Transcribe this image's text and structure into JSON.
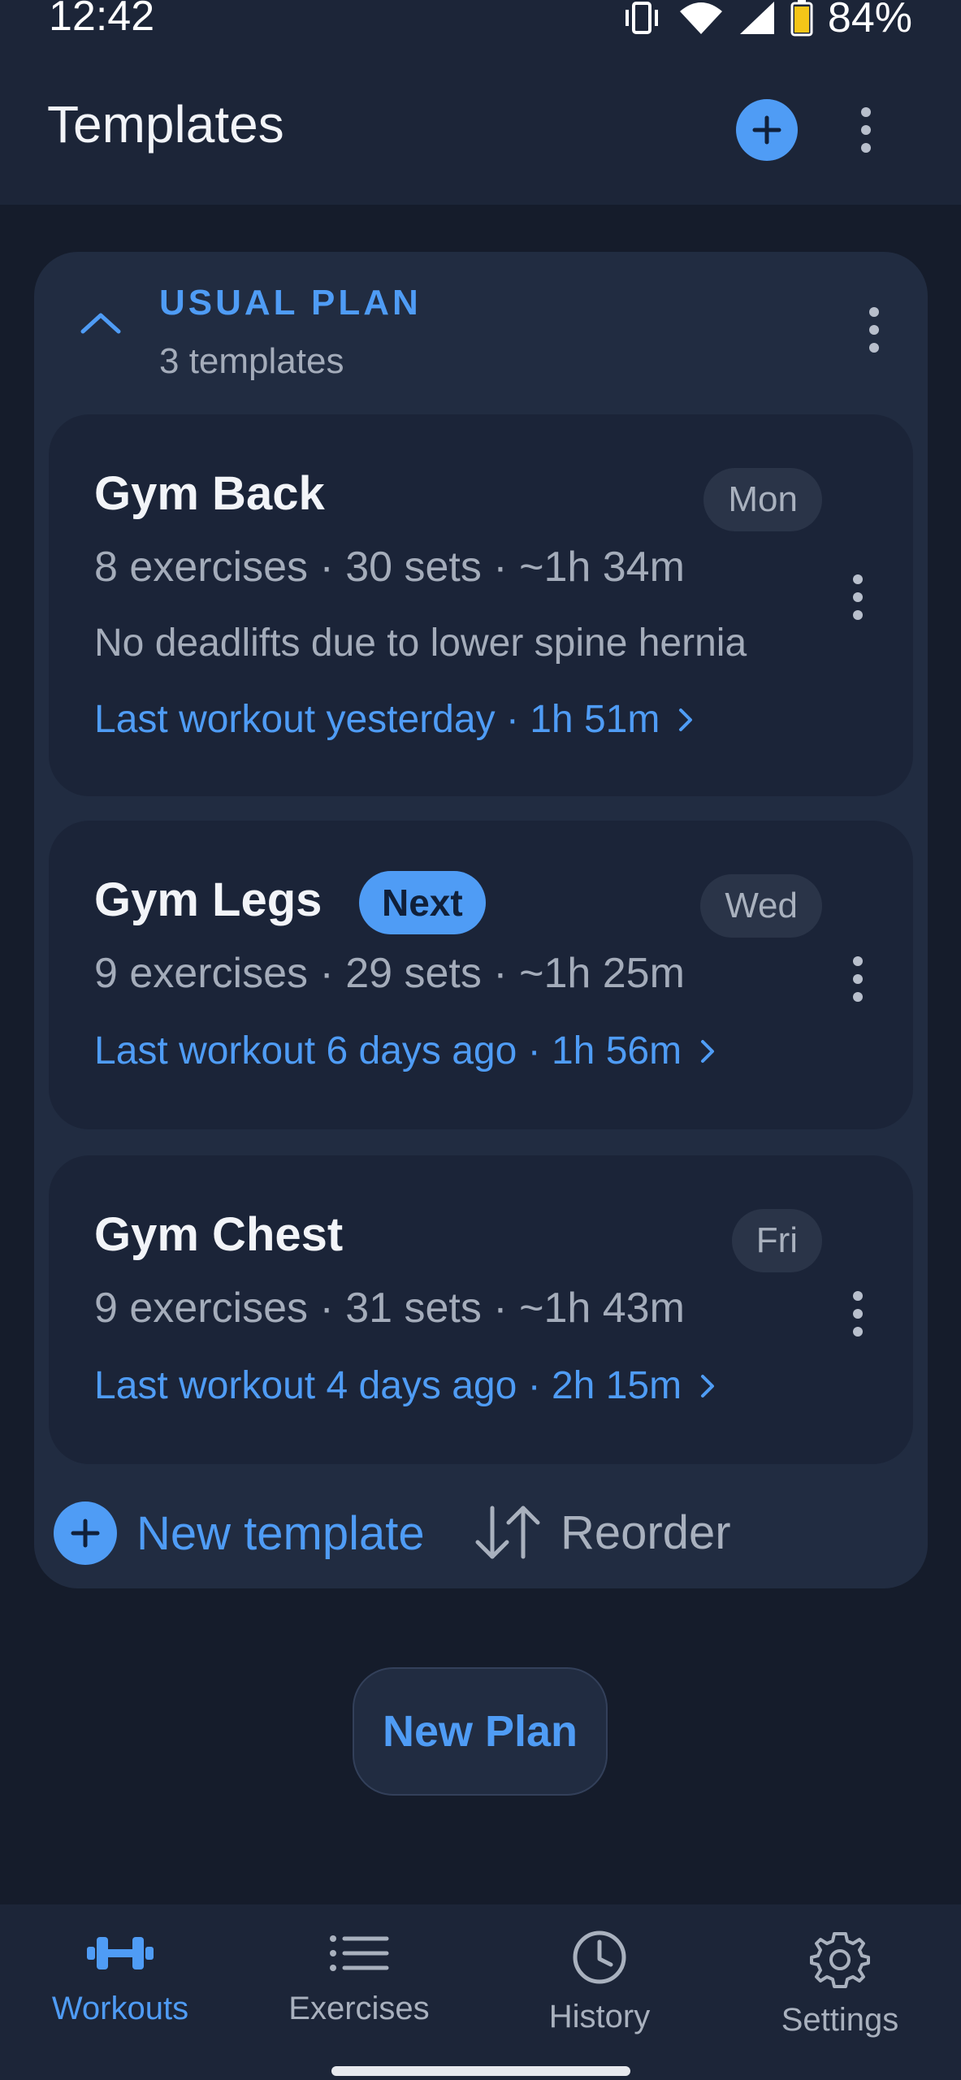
{
  "status_bar": {
    "time": "12:42",
    "battery": "84%"
  },
  "app_bar": {
    "title": "Templates"
  },
  "plan": {
    "name": "USUAL PLAN",
    "count": "3 templates",
    "templates": [
      {
        "title": "Gym Back",
        "day": "Mon",
        "stats": "8 exercises · 30 sets · ~1h 34m",
        "note": "No deadlifts due to lower spine hernia",
        "last": "Last workout yesterday · 1h 51m"
      },
      {
        "title": "Gym Legs",
        "badge": "Next",
        "day": "Wed",
        "stats": "9 exercises · 29 sets · ~1h 25m",
        "last": "Last workout 6 days ago · 1h 56m"
      },
      {
        "title": "Gym Chest",
        "day": "Fri",
        "stats": "9 exercises · 31 sets · ~1h 43m",
        "last": "Last workout 4 days ago · 2h 15m"
      }
    ],
    "new_template_label": "New template",
    "reorder_label": "Reorder"
  },
  "new_plan_label": "New Plan",
  "nav": {
    "items": [
      {
        "label": "Workouts",
        "icon": "dumbbell-icon",
        "active": true
      },
      {
        "label": "Exercises",
        "icon": "list-icon",
        "active": false
      },
      {
        "label": "History",
        "icon": "clock-icon",
        "active": false
      },
      {
        "label": "Settings",
        "icon": "gear-icon",
        "active": false
      }
    ]
  },
  "colors": {
    "accent": "#4f9cf5",
    "background": "#151c2b",
    "card": "#1b2438"
  }
}
